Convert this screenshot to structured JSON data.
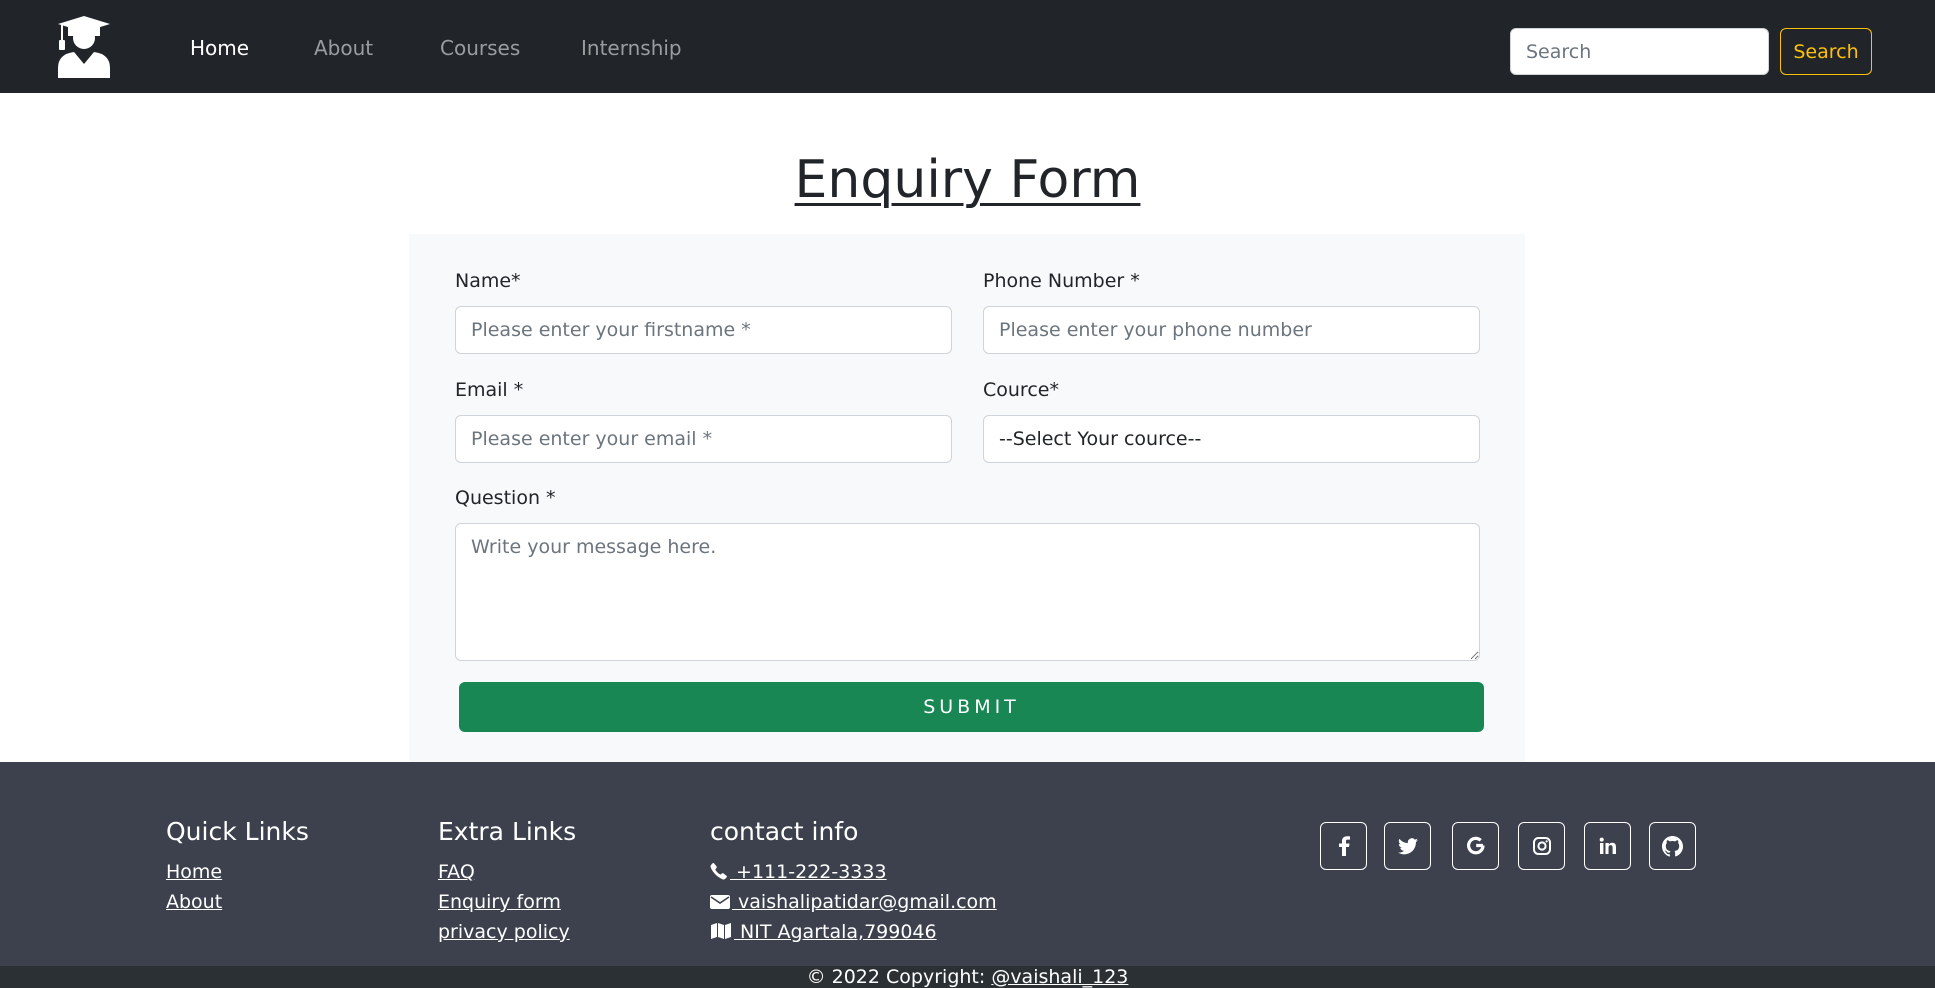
{
  "nav": {
    "logo_icon": "graduation-cap-user-icon",
    "links": [
      "Home",
      "About",
      "Courses",
      "Internship"
    ],
    "search_placeholder": "Search",
    "search_button": "Search"
  },
  "page": {
    "title": "Enquiry Form"
  },
  "form": {
    "name_label": "Name*",
    "name_placeholder": "Please enter your firstname *",
    "phone_label": "Phone Number *",
    "phone_placeholder": "Please enter your phone number",
    "email_label": "Email *",
    "email_placeholder": "Please enter your email *",
    "course_label": "Cource*",
    "course_selected": "--Select Your cource--",
    "question_label": "Question *",
    "question_placeholder": "Write your message here.",
    "submit_label": "SUBMIT"
  },
  "footer": {
    "quick_links_heading": "Quick Links",
    "quick_links": [
      "Home",
      "About"
    ],
    "extra_links_heading": "Extra Links",
    "extra_links": [
      "FAQ",
      "Enquiry form",
      "privacy policy"
    ],
    "contact_heading": "contact info",
    "phone": " +111-222-3333",
    "email": " vaishalipatidar@gmail.com",
    "address": " NIT Agartala,799046",
    "social_icons": [
      "facebook-icon",
      "twitter-icon",
      "google-icon",
      "instagram-icon",
      "linkedin-icon",
      "github-icon"
    ],
    "copyright_text": "© 2022 Copyright: ",
    "copyright_link": "@vaishali_123"
  },
  "colors": {
    "navbar_bg": "#212529",
    "search_accent": "#ffc107",
    "submit_bg": "#198754",
    "footer_bg": "#3c414d",
    "copyright_bg": "#2b3035"
  }
}
